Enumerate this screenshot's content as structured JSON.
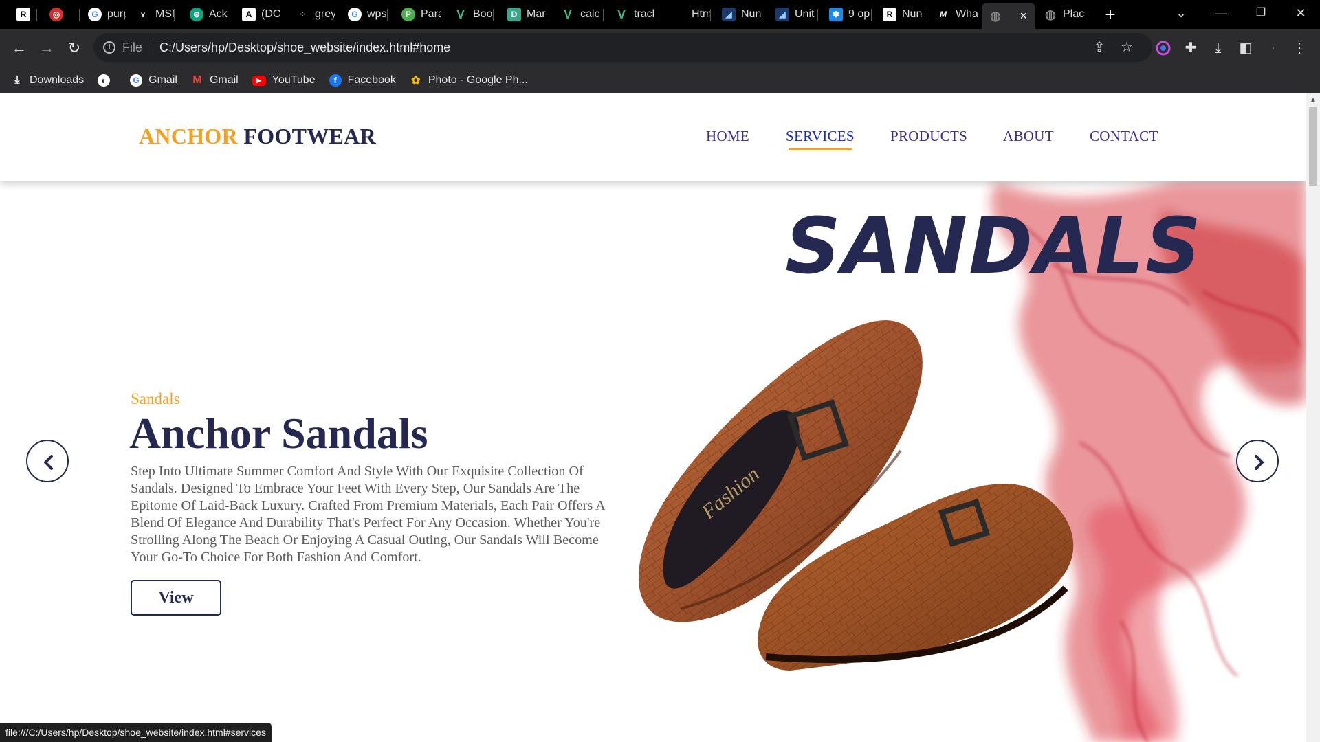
{
  "browser": {
    "tabs": [
      {
        "title": "",
        "icon": "researchgate-icon"
      },
      {
        "title": "",
        "icon": "shield-icon"
      },
      {
        "title": "purp",
        "icon": "google-icon"
      },
      {
        "title": "MSN",
        "icon": "msn-icon"
      },
      {
        "title": "Ack",
        "icon": "chatgpt-icon"
      },
      {
        "title": "(DO",
        "icon": "anthropic-icon"
      },
      {
        "title": "grey",
        "icon": "dots-icon"
      },
      {
        "title": "wps",
        "icon": "google-icon"
      },
      {
        "title": "Para",
        "icon": "paraphrase-icon"
      },
      {
        "title": "Boo",
        "icon": "vuetify-icon"
      },
      {
        "title": "Mar",
        "icon": "d-icon"
      },
      {
        "title": "calc",
        "icon": "vuetify-icon"
      },
      {
        "title": "tracl",
        "icon": "vuetify-icon"
      },
      {
        "title": "Htm",
        "icon": "blank-icon"
      },
      {
        "title": "Nun",
        "icon": "image-icon"
      },
      {
        "title": "Unit",
        "icon": "image-icon"
      },
      {
        "title": "9 op",
        "icon": "snowflake-icon"
      },
      {
        "title": "Nun",
        "icon": "researchgate-icon"
      },
      {
        "title": "Wha",
        "icon": "medium-icon"
      },
      {
        "title": "",
        "icon": "globe-icon",
        "active": true
      },
      {
        "title": "Plac",
        "icon": "globe-icon"
      }
    ],
    "active_close": "×",
    "new_tab": "+",
    "address": {
      "prefix": "File",
      "url": "C:/Users/hp/Desktop/shoe_website/index.html#home"
    },
    "bookmarks": [
      {
        "label": "Downloads",
        "icon": "download-icon"
      },
      {
        "label": "",
        "icon": "globe-icon"
      },
      {
        "label": "Gmail",
        "icon": "google-icon"
      },
      {
        "label": "Gmail",
        "icon": "gmail-icon"
      },
      {
        "label": "YouTube",
        "icon": "youtube-icon"
      },
      {
        "label": "Facebook",
        "icon": "facebook-icon"
      },
      {
        "label": "Photo - Google Ph...",
        "icon": "google-photos-icon"
      }
    ],
    "status_url": "file:///C:/Users/hp/Desktop/shoe_website/index.html#services"
  },
  "site": {
    "logo_part1": "ANCHOR",
    "logo_part2": "FOOTWEAR",
    "nav": [
      "HOME",
      "SERVICES",
      "PRODUCTS",
      "ABOUT",
      "CONTACT"
    ],
    "active_nav": "SERVICES",
    "hero": {
      "big_title": "SANDALS",
      "subtitle": "Sandals",
      "heading": "Anchor Sandals",
      "description": "Step Into Ultimate Summer Comfort And Style With Our Exquisite Collection Of Sandals. Designed To Embrace Your Feet With Every Step, Our Sandals Are The Epitome Of Laid-Back Luxury. Crafted From Premium Materials, Each Pair Offers A Blend Of Elegance And Durability That's Perfect For Any Occasion. Whether You're Strolling Along The Beach Or Enjoying A Casual Outing, Our Sandals Will Become Your Go-To Choice For Both Fashion And Comfort.",
      "button": "View",
      "insole_text": "Fashion"
    }
  },
  "colors": {
    "accent_orange": "#f6a021",
    "navy": "#252850",
    "nav_purple": "#3a2d8a",
    "smoke_red": "#d21f2b",
    "leather_brown": "#a0522d"
  }
}
